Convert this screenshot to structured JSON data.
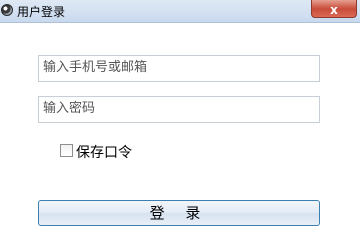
{
  "window": {
    "title": "用户登录",
    "close_symbol": "x",
    "app_icon": "app-globe-icon"
  },
  "form": {
    "account_placeholder": "输入手机号或邮箱",
    "password_placeholder": "输入密码",
    "remember_label": "保存口令",
    "remember_checked": false,
    "login_label": "登 录"
  },
  "colors": {
    "close_button": "#c94c3b",
    "login_border": "#3c7fb1"
  }
}
